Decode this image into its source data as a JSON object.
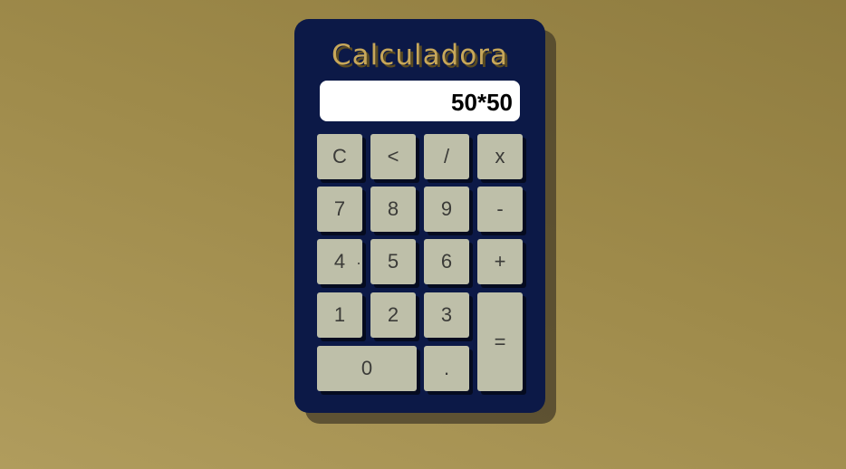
{
  "calculator": {
    "title": "Calculadora",
    "display": "50*50",
    "keys": {
      "clear": "C",
      "backspace": "<",
      "divide": "/",
      "multiply": "x",
      "seven": "7",
      "eight": "8",
      "nine": "9",
      "minus": "-",
      "four": "4",
      "five": "5",
      "six": "6",
      "plus": "+",
      "one": "1",
      "two": "2",
      "three": "3",
      "equals": "=",
      "zero": "0",
      "decimal": "."
    }
  },
  "colors": {
    "background": "#9e8a4a",
    "body": "#0c1947",
    "title": "#c7a75a",
    "key": "#bebfa9",
    "display": "#ffffff"
  }
}
